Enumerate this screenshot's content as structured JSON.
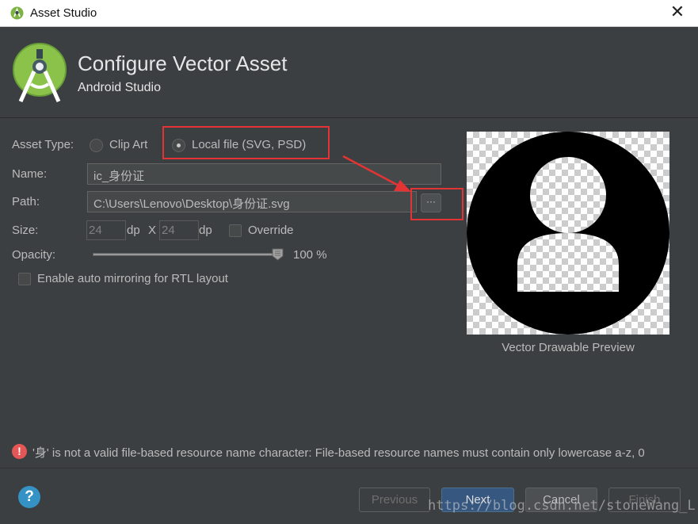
{
  "window": {
    "title": "Asset Studio"
  },
  "header": {
    "title": "Configure Vector Asset",
    "subtitle": "Android Studio"
  },
  "form": {
    "asset_type_label": "Asset Type:",
    "asset_type_options": [
      {
        "label": "Clip Art",
        "selected": false
      },
      {
        "label": "Local file (SVG, PSD)",
        "selected": true
      }
    ],
    "name_label": "Name:",
    "name_value": "ic_身份证",
    "path_label": "Path:",
    "path_value": "C:\\Users\\Lenovo\\Desktop\\身份证.svg",
    "browse_label": "···",
    "size_label": "Size:",
    "size_width": "24",
    "size_height": "24",
    "size_unit": "dp",
    "size_separator": "X",
    "override_label": "Override",
    "override_checked": false,
    "opacity_label": "Opacity:",
    "opacity_value": "100 %",
    "opacity_level": 1.0,
    "rtl_label": "Enable auto mirroring for RTL layout",
    "rtl_checked": false
  },
  "preview": {
    "caption": "Vector Drawable Preview",
    "icon": "account-circle-icon"
  },
  "error": {
    "icon": "error-icon",
    "text": "'身' is not a valid file-based resource name character: File-based resource names must contain only lowercase a-z, 0"
  },
  "footer": {
    "help_label": "?",
    "previous_label": "Previous",
    "next_label": "Next",
    "cancel_label": "Cancel",
    "finish_label": "Finish"
  },
  "watermark": "https://blog.csdn.net/stoneWang_L",
  "colors": {
    "background": "#3c3f41",
    "accent": "#365880",
    "annotation": "#e23434",
    "error": "#e45756"
  }
}
